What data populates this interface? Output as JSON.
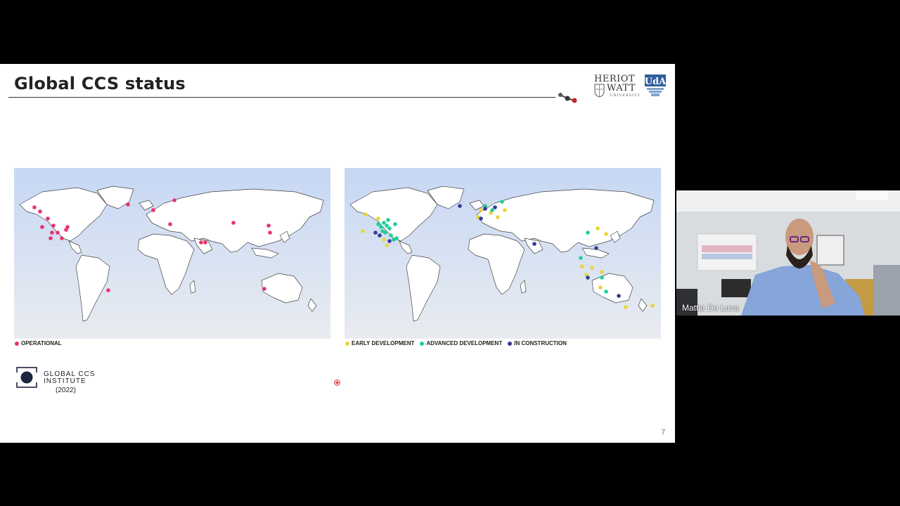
{
  "slide": {
    "title": "Global CCS status",
    "page_number": "7",
    "logos": {
      "heriot_watt": [
        "HERIOT",
        "WATT",
        "UNIVERSITY"
      ],
      "uda": "UdA"
    },
    "maps": {
      "left": {
        "legend": [
          {
            "label": "OPERATIONAL",
            "color": "#e8336d"
          }
        ]
      },
      "right": {
        "legend": [
          {
            "label": "EARLY DEVELOPMENT",
            "color": "#e8d63a"
          },
          {
            "label": "ADVANCED DEVELOPMENT",
            "color": "#1fcf9a"
          },
          {
            "label": "IN CONSTRUCTION",
            "color": "#35399a"
          }
        ]
      }
    },
    "source": {
      "line1": "GLOBAL CCS",
      "line2": "INSTITUTE",
      "year": "(2022)"
    }
  },
  "webcam": {
    "participant_name": "Mattia De Luca"
  },
  "colors": {
    "operational": "#e8336d",
    "early": "#e8d63a",
    "advanced": "#1fcf9a",
    "construction": "#35399a",
    "ocean_top": "#c6d7f4",
    "ocean_bottom": "#e9ecf0"
  }
}
